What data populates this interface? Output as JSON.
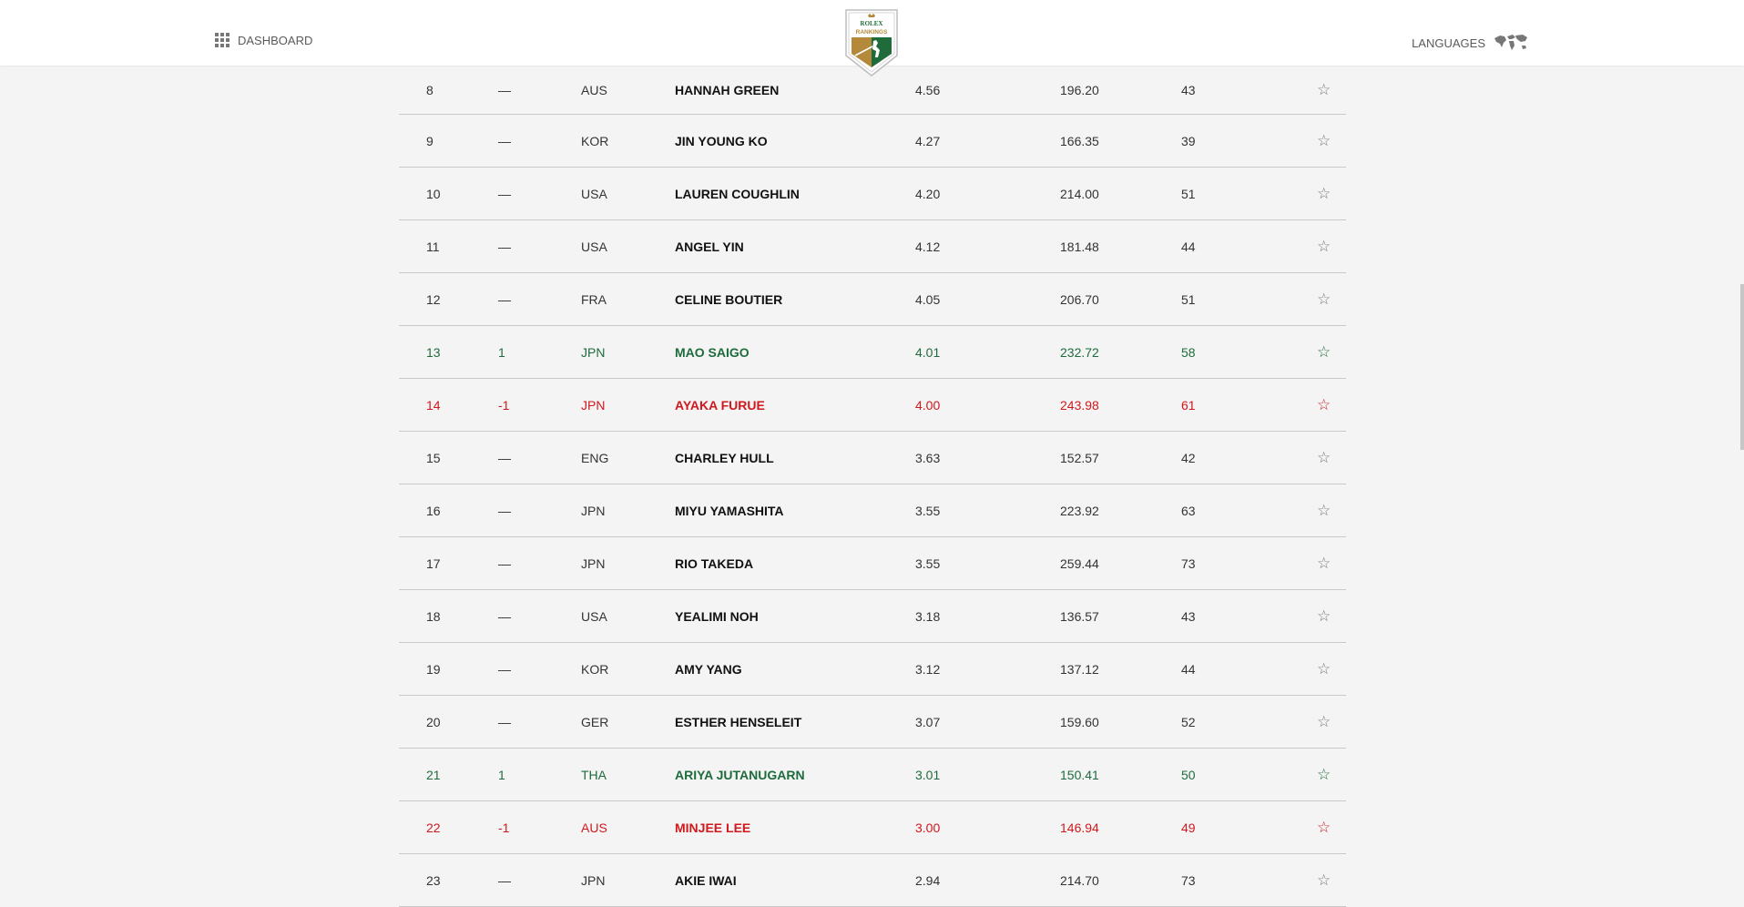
{
  "header": {
    "dashboard_label": "DASHBOARD",
    "languages_label": "LANGUAGES",
    "logo": {
      "line1": "ROLEX",
      "line2": "RANKINGS"
    }
  },
  "colors": {
    "up": "#1e6b3c",
    "down": "#d0181d",
    "logo_gold": "#b48a3a",
    "logo_green": "#1f6b3a"
  },
  "rankings": [
    {
      "rank": "8",
      "move": "—",
      "nat": "AUS",
      "name": "HANNAH GREEN",
      "avg": "4.56",
      "total": "196.20",
      "events": "43",
      "trend": "same"
    },
    {
      "rank": "9",
      "move": "—",
      "nat": "KOR",
      "name": "JIN YOUNG KO",
      "avg": "4.27",
      "total": "166.35",
      "events": "39",
      "trend": "same"
    },
    {
      "rank": "10",
      "move": "—",
      "nat": "USA",
      "name": "LAUREN COUGHLIN",
      "avg": "4.20",
      "total": "214.00",
      "events": "51",
      "trend": "same"
    },
    {
      "rank": "11",
      "move": "—",
      "nat": "USA",
      "name": "ANGEL YIN",
      "avg": "4.12",
      "total": "181.48",
      "events": "44",
      "trend": "same"
    },
    {
      "rank": "12",
      "move": "—",
      "nat": "FRA",
      "name": "CELINE BOUTIER",
      "avg": "4.05",
      "total": "206.70",
      "events": "51",
      "trend": "same"
    },
    {
      "rank": "13",
      "move": "1",
      "nat": "JPN",
      "name": "MAO SAIGO",
      "avg": "4.01",
      "total": "232.72",
      "events": "58",
      "trend": "up"
    },
    {
      "rank": "14",
      "move": "-1",
      "nat": "JPN",
      "name": "AYAKA FURUE",
      "avg": "4.00",
      "total": "243.98",
      "events": "61",
      "trend": "down"
    },
    {
      "rank": "15",
      "move": "—",
      "nat": "ENG",
      "name": "CHARLEY HULL",
      "avg": "3.63",
      "total": "152.57",
      "events": "42",
      "trend": "same"
    },
    {
      "rank": "16",
      "move": "—",
      "nat": "JPN",
      "name": "MIYU YAMASHITA",
      "avg": "3.55",
      "total": "223.92",
      "events": "63",
      "trend": "same"
    },
    {
      "rank": "17",
      "move": "—",
      "nat": "JPN",
      "name": "RIO TAKEDA",
      "avg": "3.55",
      "total": "259.44",
      "events": "73",
      "trend": "same"
    },
    {
      "rank": "18",
      "move": "—",
      "nat": "USA",
      "name": "YEALIMI NOH",
      "avg": "3.18",
      "total": "136.57",
      "events": "43",
      "trend": "same"
    },
    {
      "rank": "19",
      "move": "—",
      "nat": "KOR",
      "name": "AMY YANG",
      "avg": "3.12",
      "total": "137.12",
      "events": "44",
      "trend": "same"
    },
    {
      "rank": "20",
      "move": "—",
      "nat": "GER",
      "name": "ESTHER HENSELEIT",
      "avg": "3.07",
      "total": "159.60",
      "events": "52",
      "trend": "same"
    },
    {
      "rank": "21",
      "move": "1",
      "nat": "THA",
      "name": "ARIYA JUTANUGARN",
      "avg": "3.01",
      "total": "150.41",
      "events": "50",
      "trend": "up"
    },
    {
      "rank": "22",
      "move": "-1",
      "nat": "AUS",
      "name": "MINJEE LEE",
      "avg": "3.00",
      "total": "146.94",
      "events": "49",
      "trend": "down"
    },
    {
      "rank": "23",
      "move": "—",
      "nat": "JPN",
      "name": "AKIE IWAI",
      "avg": "2.94",
      "total": "214.70",
      "events": "73",
      "trend": "same"
    }
  ],
  "icons": {
    "dashboard": "grid-icon",
    "languages": "world-map-icon",
    "favorite": "star-outline-icon"
  }
}
